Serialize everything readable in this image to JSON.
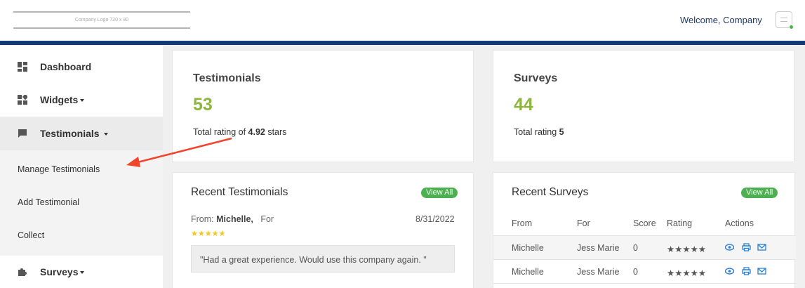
{
  "header": {
    "logo_text": "Company Logo 720 x 80",
    "welcome": "Welcome, Company"
  },
  "sidebar": {
    "items": [
      {
        "label": "Dashboard",
        "icon": "dashboard-icon"
      },
      {
        "label": "Widgets",
        "icon": "widgets-icon"
      },
      {
        "label": "Testimonials",
        "icon": "chat-icon"
      },
      {
        "label": "Surveys",
        "icon": "puzzle-icon"
      }
    ],
    "submenu": [
      "Manage Testimonials",
      "Add Testimonial",
      "Collect"
    ]
  },
  "testimonials_card": {
    "title": "Testimonials",
    "count": "53",
    "rating_prefix": "Total rating of ",
    "rating_value": "4.92",
    "rating_suffix": " stars"
  },
  "surveys_card": {
    "title": "Surveys",
    "count": "44",
    "rating_prefix": "Total rating ",
    "rating_value": "5"
  },
  "recent_testimonials": {
    "title": "Recent Testimonials",
    "view_all": "View All",
    "from_label": "From: ",
    "from_name": "Michelle,",
    "for_label": "For",
    "date": "8/31/2022",
    "stars": "★★★★★",
    "quote": "\"Had a great experience. Would use this company again. \""
  },
  "recent_surveys": {
    "title": "Recent Surveys",
    "view_all": "View All",
    "columns": [
      "From",
      "For",
      "Score",
      "Rating",
      "Actions"
    ],
    "rows": [
      {
        "from": "Michelle",
        "for": "Jess Marie",
        "score": "0",
        "rating": "★★★★★"
      },
      {
        "from": "Michelle",
        "for": "Jess Marie",
        "score": "0",
        "rating": "★★★★★"
      }
    ]
  },
  "colors": {
    "accent": "#173b78",
    "stat_green": "#8db63c",
    "badge_green": "#4caf50",
    "star": "#f5c518",
    "action_blue": "#2a7fd4",
    "annotation_arrow": "#f0442b"
  }
}
